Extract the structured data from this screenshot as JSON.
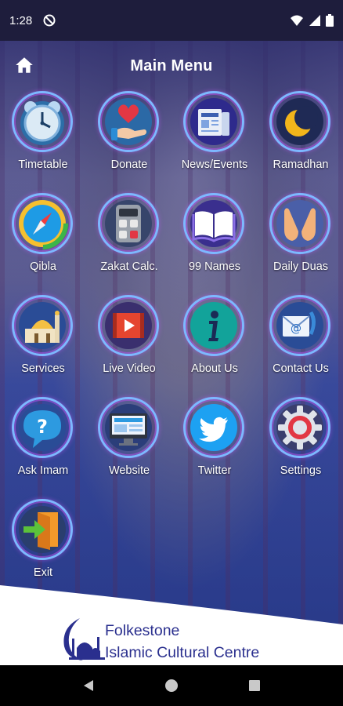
{
  "status_bar": {
    "time": "1:28"
  },
  "header": {
    "title": "Main Menu"
  },
  "menu": [
    {
      "label": "Timetable",
      "icon": "alarm-clock-icon"
    },
    {
      "label": "Donate",
      "icon": "donate-hand-heart-icon"
    },
    {
      "label": "News/Events",
      "icon": "newspaper-icon"
    },
    {
      "label": "Ramadhan",
      "icon": "crescent-moon-icon"
    },
    {
      "label": "Qibla",
      "icon": "compass-icon"
    },
    {
      "label": "Zakat Calc.",
      "icon": "calculator-icon"
    },
    {
      "label": "99 Names",
      "icon": "open-book-icon"
    },
    {
      "label": "Daily Duas",
      "icon": "praying-hands-icon"
    },
    {
      "label": "Services",
      "icon": "mosque-icon"
    },
    {
      "label": "Live Video",
      "icon": "video-play-icon"
    },
    {
      "label": "About Us",
      "icon": "info-icon"
    },
    {
      "label": "Contact Us",
      "icon": "email-phone-icon"
    },
    {
      "label": "Ask Imam",
      "icon": "question-bubble-icon"
    },
    {
      "label": "Website",
      "icon": "monitor-icon"
    },
    {
      "label": "Twitter",
      "icon": "twitter-bird-icon"
    },
    {
      "label": "Settings",
      "icon": "gear-icon"
    },
    {
      "label": "Exit",
      "icon": "exit-door-icon"
    }
  ],
  "footer": {
    "line1": "Folkestone",
    "line2": "Islamic Cultural Centre"
  },
  "colors": {
    "accent_ring": "#7db8ff",
    "footer_text": "#2a2f8e",
    "header_bg": "#1e1d3c"
  }
}
